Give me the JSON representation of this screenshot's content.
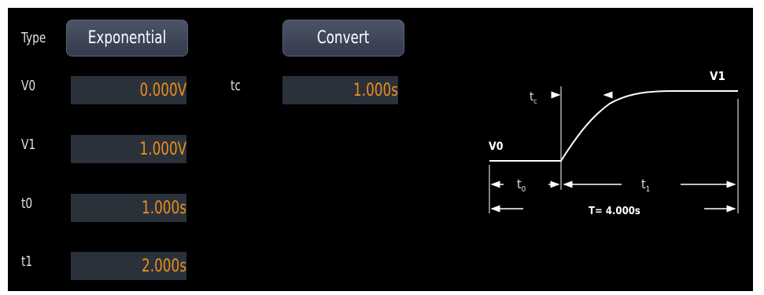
{
  "type": {
    "label": "Type",
    "value": "Exponential"
  },
  "convert_label": "Convert",
  "fields": {
    "v0": {
      "label": "V0",
      "value": "0.000V"
    },
    "v1": {
      "label": "V1",
      "value": "1.000V"
    },
    "t0": {
      "label": "t0",
      "value": "1.000s"
    },
    "t1": {
      "label": "t1",
      "value": "2.000s"
    },
    "tc": {
      "label": "tc",
      "value": "1.000s"
    }
  },
  "diagram": {
    "v0_label": "V0",
    "v1_label": "V1",
    "tc_label": "t",
    "tc_sub": "c",
    "t0_label": "t",
    "t0_sub": "0",
    "t1_label": "t",
    "t1_sub": "1",
    "period_label": "T= 4.000s"
  },
  "colors": {
    "background": "#000000",
    "field_bg": "#2b313b",
    "value_text": "#ec8f1c",
    "button_bg": "#404657",
    "label_text": "#e0e0e0"
  }
}
